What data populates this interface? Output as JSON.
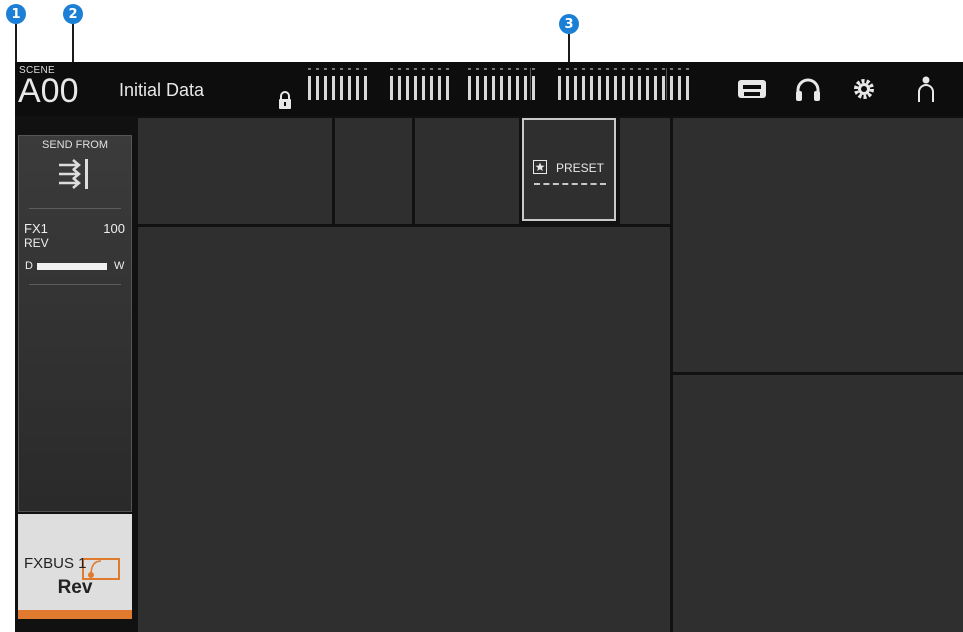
{
  "callouts": [
    "1",
    "2",
    "3"
  ],
  "header": {
    "scene_label": "SCENE",
    "scene_number": "A00",
    "scene_name": "Initial Data"
  },
  "toolbar_icons": [
    "lock-icon",
    "recorder-icon",
    "headphones-icon",
    "settings-gear-icon",
    "user-icon"
  ],
  "strip": {
    "title": "SEND FROM",
    "icon": "send-from-arrows-icon",
    "fx_name": "FX1",
    "fx_level": "100",
    "fx_type": "REV",
    "mix_left": "D",
    "mix_right": "W"
  },
  "fxbus": {
    "name": "FXBUS 1",
    "type": "Rev",
    "icon": "fx-rack-icon"
  },
  "preset": {
    "label": "PRESET",
    "icon": "star-box-icon"
  },
  "colors": {
    "callout": "#1c7fd6",
    "accent": "#e07a2e",
    "panel": "#2f2f2f",
    "background": "#111111"
  }
}
